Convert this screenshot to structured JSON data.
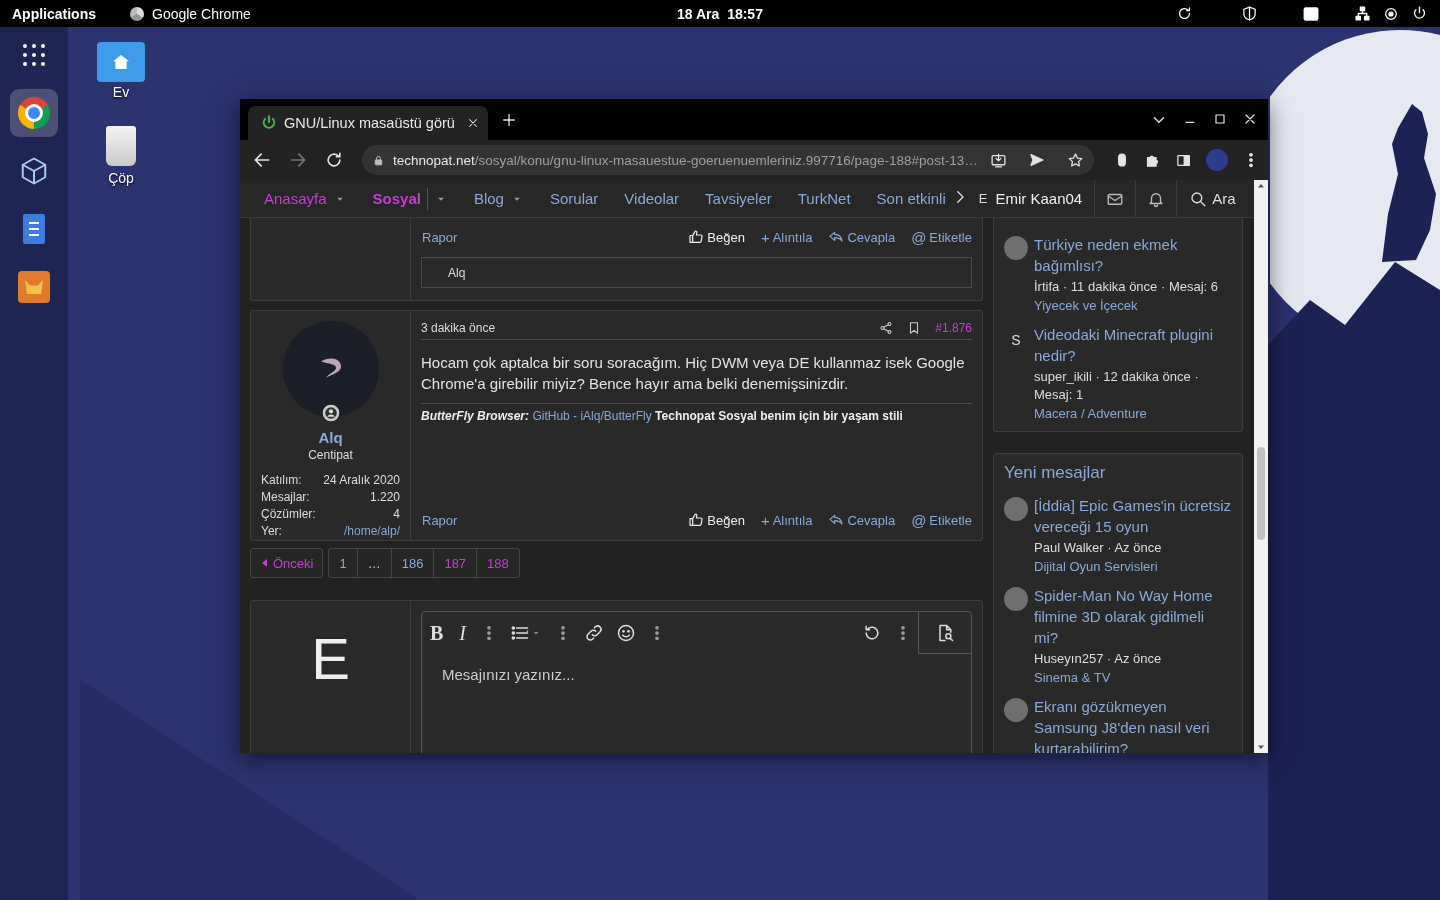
{
  "top_bar": {
    "menu": "Applications",
    "app": "Google Chrome",
    "clock": "18 Ara  18:57"
  },
  "dock": {
    "items": [
      {
        "kind": "apps",
        "selected": false
      },
      {
        "kind": "chrome",
        "selected": true
      },
      {
        "kind": "cube",
        "selected": false
      },
      {
        "kind": "notes",
        "selected": false
      },
      {
        "kind": "game",
        "selected": false
      }
    ]
  },
  "desktop_icons": [
    {
      "kind": "home",
      "label": "Ev"
    },
    {
      "kind": "trash",
      "label": "Çöp"
    }
  ],
  "browser": {
    "tab": {
      "title": "GNU/Linux masaüstü görü"
    },
    "nav_buttons": [
      {
        "kind": "back",
        "disabled": false
      },
      {
        "kind": "forward",
        "disabled": true
      },
      {
        "kind": "reload",
        "disabled": false
      }
    ],
    "address": {
      "domain": "technopat.net",
      "path": "/sosyal/konu/gnu-linux-masauestue-goeruenuemleriniz.997716/page-188#post-13…"
    }
  },
  "site_nav": {
    "items": [
      {
        "label": "Anasayfa",
        "selected": false,
        "visited": true,
        "has_menu": true
      },
      {
        "label": "Sosyal",
        "selected": true,
        "visited": true,
        "has_menu": true
      },
      {
        "label": "Blog",
        "selected": false,
        "visited": false,
        "has_menu": true
      },
      {
        "label": "Sorular",
        "selected": false,
        "visited": false,
        "has_menu": false
      },
      {
        "label": "Videolar",
        "selected": false,
        "visited": false,
        "has_menu": false
      },
      {
        "label": "Tavsiyeler",
        "selected": false,
        "visited": false,
        "has_menu": false
      },
      {
        "label": "TurkNet",
        "selected": false,
        "visited": false,
        "has_menu": false
      },
      {
        "label": "Son etkinli",
        "selected": false,
        "visited": false,
        "has_menu": false
      }
    ],
    "user": {
      "initial": "E",
      "name": "Emir Kaan04"
    },
    "search": "Ara"
  },
  "posts": [
    {
      "kind": "partial",
      "report": "Rapor",
      "actions": [
        {
          "kind": "like",
          "label": "Beğen"
        },
        {
          "kind": "quote",
          "icon": "+",
          "label": "Alıntıla"
        },
        {
          "kind": "reply",
          "label": "Cevapla"
        },
        {
          "kind": "mention",
          "icon": "@",
          "label": "Etiketle"
        }
      ],
      "liked_by": "Alq"
    },
    {
      "kind": "full",
      "author": {
        "name": "Alq",
        "title": "Centipat",
        "stats": [
          {
            "label": "Katılım:",
            "value": "24 Aralık 2020",
            "link": false
          },
          {
            "label": "Mesajlar:",
            "value": "1.220",
            "link": false
          },
          {
            "label": "Çözümler:",
            "value": "4",
            "link": false
          },
          {
            "label": "Yer:",
            "value": "/home/alp/",
            "link": true
          }
        ]
      },
      "time": "3 dakika önce",
      "number": "#1.876",
      "body": "Hocam çok aptalca bir soru soracağım. Hiç DWM veya DE kullanmaz isek Google Chrome'a girebilir miyiz? Bence hayır ama belki denemişsinizdir.",
      "signature": {
        "lead": "ButterFly Browser:",
        "link": "GitHub - iAlq/ButterFly",
        "tagline": "Technopat Sosyal benim için bir yaşam stili"
      },
      "report": "Rapor",
      "actions": [
        {
          "kind": "like",
          "label": "Beğen"
        },
        {
          "kind": "quote",
          "icon": "+",
          "label": "Alıntıla"
        },
        {
          "kind": "reply",
          "label": "Cevapla"
        },
        {
          "kind": "mention",
          "icon": "@",
          "label": "Etiketle"
        }
      ]
    }
  ],
  "pagination": {
    "previous": {
      "label": "Önceki",
      "visited": true
    },
    "pages": [
      {
        "kind": "page",
        "label": "1",
        "visited": false
      },
      {
        "kind": "gap",
        "label": "…"
      },
      {
        "kind": "page",
        "label": "186",
        "visited": false
      },
      {
        "kind": "page",
        "label": "187",
        "visited": true
      },
      {
        "kind": "page",
        "label": "188",
        "visited": true
      }
    ]
  },
  "reply_editor": {
    "initial": "E",
    "toolbar": [
      {
        "kind": "bold",
        "glyph": "B"
      },
      {
        "kind": "italic",
        "glyph": "I"
      },
      {
        "kind": "more"
      },
      {
        "kind": "list"
      },
      {
        "kind": "more"
      },
      {
        "kind": "link"
      },
      {
        "kind": "emoji"
      },
      {
        "kind": "more"
      },
      {
        "kind": "spacer"
      },
      {
        "kind": "undo"
      },
      {
        "kind": "more"
      },
      {
        "kind": "preview"
      }
    ],
    "placeholder": "Mesajınızı yazınız..."
  },
  "sidebar": [
    {
      "items": [
        {
          "kind": "photo",
          "title": "Türkiye neden ekmek bağımlısı?",
          "meta": "İrtifa · 11 dakika önce · Mesaj: 6",
          "forum": "Yiyecek ve İçecek"
        },
        {
          "kind": "letter",
          "letter": "S",
          "title": "Videodaki Minecraft plugini nedir?",
          "meta": "super_ikili · 12 dakika önce · Mesaj: 1",
          "forum": "Macera / Adventure"
        }
      ]
    },
    {
      "title": "Yeni mesajlar",
      "items": [
        {
          "kind": "photo",
          "title": "[İddia] Epic Games'in ücretsiz vereceği 15 oyun",
          "meta": "Paul Walker · Az önce",
          "forum": "Dijital Oyun Servisleri"
        },
        {
          "kind": "photo",
          "title": "Spider-Man No Way Home filmine 3D olarak gidilmeli mi?",
          "meta": "Huseyın257 · Az önce",
          "forum": "Sinema & TV"
        },
        {
          "kind": "photo",
          "title": "Ekranı gözükmeyen Samsung J8'den nasıl veri kurtarabilirim?"
        }
      ]
    }
  ]
}
